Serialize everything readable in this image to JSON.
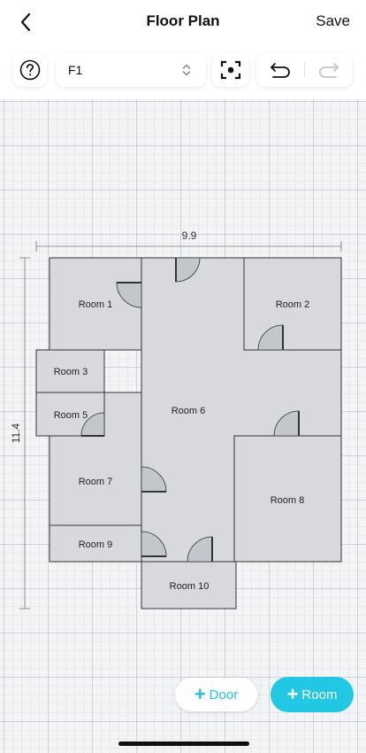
{
  "header": {
    "title": "Floor Plan",
    "save_label": "Save"
  },
  "toolbar": {
    "floor_value": "F1"
  },
  "plan": {
    "width_label": "9.9",
    "height_label": "11.4",
    "rooms": [
      {
        "name": "Room 1"
      },
      {
        "name": "Room 2"
      },
      {
        "name": "Room 3"
      },
      {
        "name": "Room 5"
      },
      {
        "name": "Room 6"
      },
      {
        "name": "Room 7"
      },
      {
        "name": "Room 8"
      },
      {
        "name": "Room 9"
      },
      {
        "name": "Room 10"
      }
    ]
  },
  "actions": {
    "door_label": "Door",
    "room_label": "Room"
  },
  "colors": {
    "accent": "#22c8e3",
    "room_fill": "#d7d9dc"
  }
}
